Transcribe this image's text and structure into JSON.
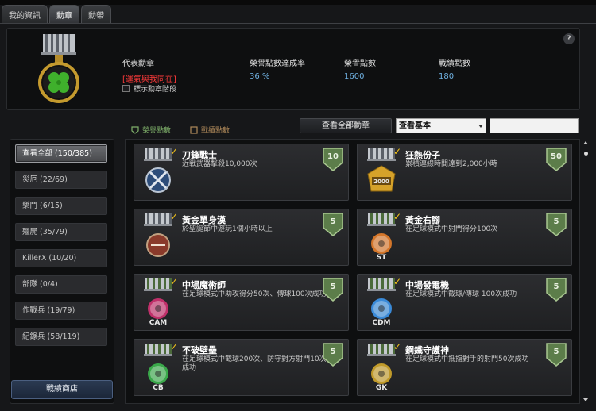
{
  "tabs": [
    "我的資訊",
    "勳章",
    "勳帶"
  ],
  "active_tab": 1,
  "profile": {
    "rep_label": "代表勳章",
    "rep_value": "[運氣與我同在]",
    "honor_rate_label": "榮譽點數達成率",
    "honor_rate_value": "36 %",
    "honor_label": "榮譽點數",
    "honor_value": "1600",
    "war_label": "戰績點數",
    "war_value": "180",
    "show_tier_label": "標示勳章階段",
    "help_label": "?"
  },
  "legend": {
    "honor": "榮譽點數",
    "war": "戰績點數"
  },
  "toolbar": {
    "view_all_label": "查看全部勳章",
    "view_select_value": "查看基本",
    "search_value": ""
  },
  "sidebar": {
    "items": [
      "查看全部 (150/385)",
      "災厄 (22/69)",
      "樂鬥 (6/15)",
      "殭屍 (35/79)",
      "KillerX (10/20)",
      "部隊 (0/4)",
      "作戰兵 (19/79)",
      "紀錄兵 (58/119)"
    ],
    "shop_label": "戰績商店"
  },
  "medals": [
    {
      "title": "刀鋒戰士",
      "desc": "近戰武器擊殺10,000次",
      "points": "10",
      "icon": "crossed-blades-medal-icon",
      "badge": ""
    },
    {
      "title": "狂熱份子",
      "desc": "累積連線時間達到2,000小時",
      "points": "50",
      "icon": "gold-2000-medal-icon",
      "badge": "2000"
    },
    {
      "title": "黃金單身漢",
      "desc": "於聖誕節中遊玩1個小時以上",
      "points": "5",
      "icon": "no-heart-medal-icon",
      "badge": ""
    },
    {
      "title": "黃金右腳",
      "desc": "在足球模式中射門得分100次",
      "points": "5",
      "icon": "ball-st-medal-icon",
      "badge": "ST"
    },
    {
      "title": "中場魔術師",
      "desc": "在足球模式中助攻得分50次、傳球100次成功",
      "points": "5",
      "icon": "ball-cam-medal-icon",
      "badge": "CAM"
    },
    {
      "title": "中場發電機",
      "desc": "在足球模式中截球/傳球 100次成功",
      "points": "5",
      "icon": "ball-cdm-medal-icon",
      "badge": "CDM"
    },
    {
      "title": "不破壁壘",
      "desc": "在足球模式中截球200次、防守對方射門10次成功",
      "points": "5",
      "icon": "ball-cb-medal-icon",
      "badge": "CB"
    },
    {
      "title": "鋼鐵守護神",
      "desc": "在足球模式中抵擋對手的射門50次成功",
      "points": "5",
      "icon": "ball-gk-medal-icon",
      "badge": "GK"
    }
  ],
  "colors": {
    "accent_red": "#ff3a3a",
    "value_blue": "#6fb0e0",
    "check_gold": "#f2c21a",
    "shield_green": "#5c7d4a"
  }
}
